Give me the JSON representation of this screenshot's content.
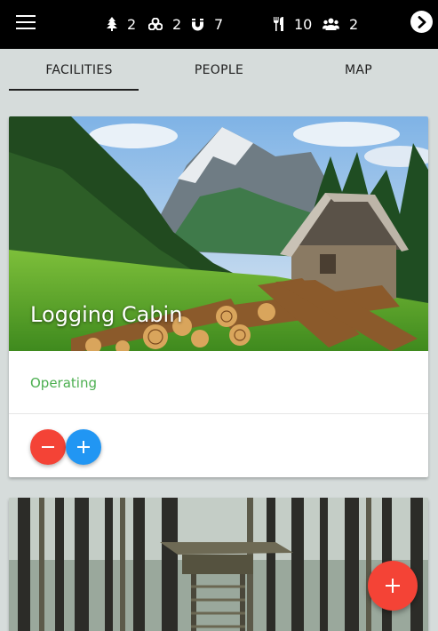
{
  "header": {
    "resources": [
      {
        "icon": "tree-icon",
        "value": "2"
      },
      {
        "icon": "stones-icon",
        "value": "2"
      },
      {
        "icon": "magnet-icon",
        "value": "7"
      },
      {
        "icon": "utensils-icon",
        "value": "10"
      },
      {
        "icon": "people-icon",
        "value": "2"
      }
    ]
  },
  "tabs": [
    {
      "label": "FACILITIES",
      "active": true
    },
    {
      "label": "PEOPLE",
      "active": false
    },
    {
      "label": "MAP",
      "active": false
    }
  ],
  "facilities": [
    {
      "name": "Logging Cabin",
      "status": "Operating",
      "status_color": "#4caf50"
    },
    {
      "name": "",
      "status": ""
    }
  ],
  "colors": {
    "remove_button": "#f44336",
    "add_button": "#2196f3",
    "fab": "#f44336",
    "topbar": "#000000",
    "background": "#d6dcdb"
  }
}
